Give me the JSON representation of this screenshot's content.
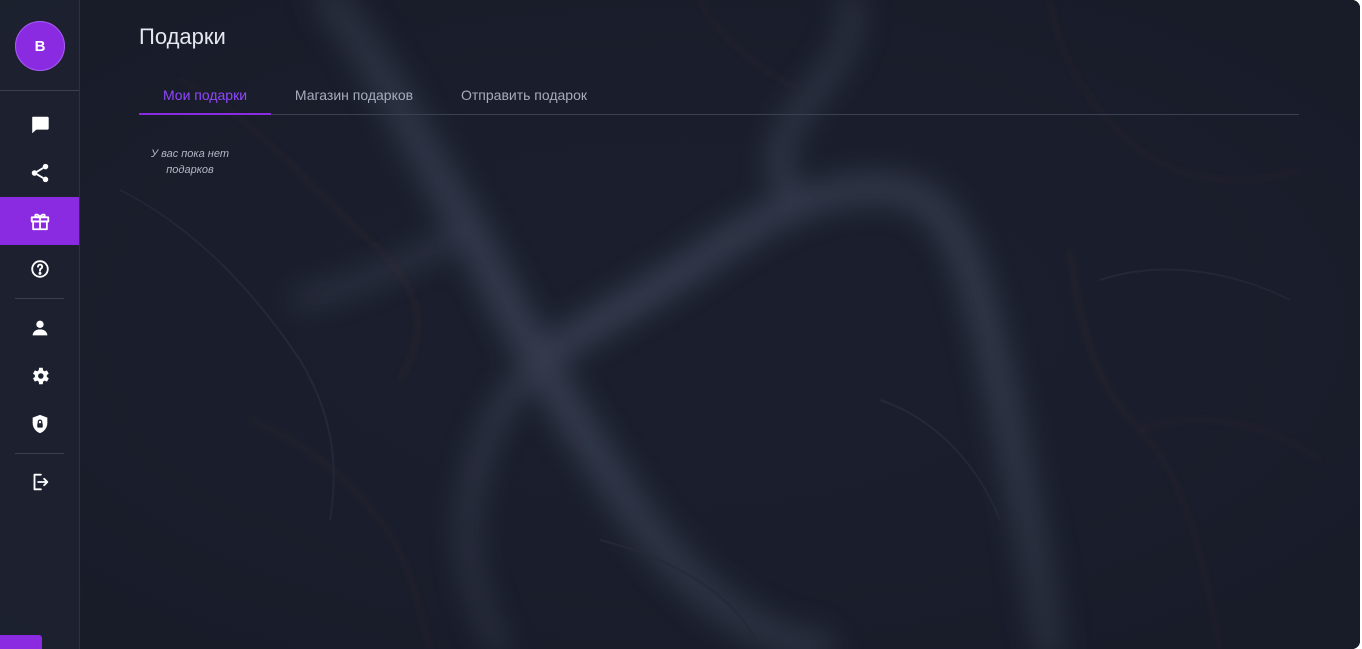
{
  "user": {
    "avatar_letter": "B"
  },
  "sidebar": {
    "items": [
      {
        "name": "chat",
        "icon": "chat-icon",
        "active": false
      },
      {
        "name": "share",
        "icon": "share-icon",
        "active": false
      },
      {
        "name": "gifts",
        "icon": "gift-icon",
        "active": true
      },
      {
        "name": "help",
        "icon": "help-icon",
        "active": false
      },
      {
        "name": "profile",
        "icon": "user-icon",
        "active": false
      },
      {
        "name": "settings",
        "icon": "gear-icon",
        "active": false
      },
      {
        "name": "security",
        "icon": "shield-lock-icon",
        "active": false
      },
      {
        "name": "logout",
        "icon": "logout-icon",
        "active": false
      }
    ]
  },
  "page": {
    "title": "Подарки"
  },
  "tabs": [
    {
      "label": "Мои подарки",
      "active": true
    },
    {
      "label": "Магазин подарков",
      "active": false
    },
    {
      "label": "Отправить подарок",
      "active": false
    }
  ],
  "empty_state": {
    "message": "У вас пока нет подарков"
  },
  "colors": {
    "accent": "#8a2be2",
    "accent_text": "#9147ff",
    "background": "#1b1f2d",
    "sidebar": "#1e2230"
  }
}
